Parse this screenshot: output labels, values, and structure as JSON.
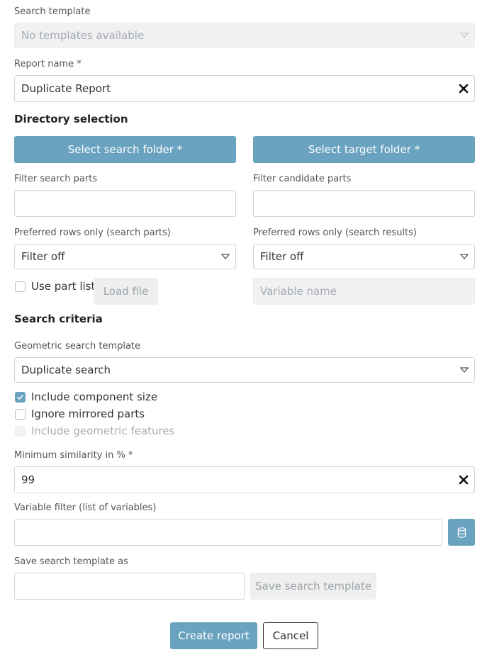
{
  "search_template": {
    "label": "Search template",
    "value": "No templates available"
  },
  "report_name": {
    "label": "Report name *",
    "value": "Duplicate Report"
  },
  "directory_selection": {
    "heading": "Directory selection",
    "search_folder_button": "Select search folder *",
    "target_folder_button": "Select target folder *",
    "filter_search_label": "Filter search parts",
    "filter_search_value": "",
    "filter_candidate_label": "Filter candidate parts",
    "filter_candidate_value": "",
    "preferred_search_label": "Preferred rows only (search parts)",
    "preferred_search_value": "Filter off",
    "preferred_results_label": "Preferred rows only (search results)",
    "preferred_results_value": "Filter off",
    "use_part_list_label": "Use part list",
    "use_part_list_checked": false,
    "load_file_button": "Load file",
    "variable_name_placeholder": "Variable name"
  },
  "search_criteria": {
    "heading": "Search criteria",
    "geometric_template_label": "Geometric search template",
    "geometric_template_value": "Duplicate search",
    "include_component_size_label": "Include component size",
    "include_component_size_checked": true,
    "ignore_mirrored_label": "Ignore mirrored parts",
    "ignore_mirrored_checked": false,
    "include_geometric_features_label": "Include geometric features",
    "include_geometric_features_checked": false,
    "min_similarity_label": "Minimum similarity in % *",
    "min_similarity_value": "99",
    "variable_filter_label": "Variable filter (list of variables)",
    "variable_filter_value": "",
    "save_template_label": "Save search template as",
    "save_template_value": "",
    "save_template_button": "Save search template"
  },
  "footer": {
    "create_button": "Create report",
    "cancel_button": "Cancel"
  },
  "colors": {
    "accent": "#6aa3c0",
    "disabled_bg": "#f0f1f2",
    "border": "#cfd4d8"
  },
  "icons": {
    "dropdown": "chevron-down-icon",
    "clear": "close-icon",
    "variables": "database-icon",
    "checkmark": "check-icon"
  }
}
